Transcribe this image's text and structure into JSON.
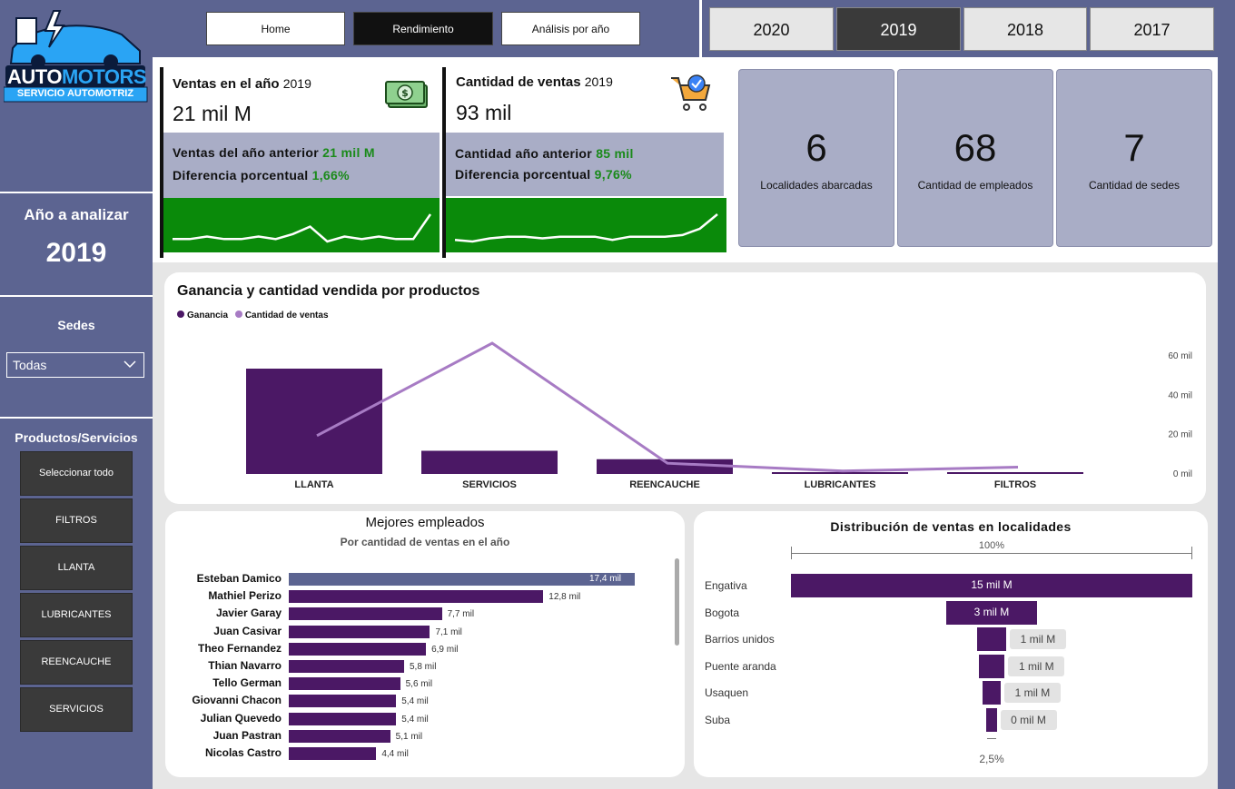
{
  "brand": {
    "name_a": "AUTO",
    "name_b": "MOTORS",
    "tagline": "SERVICIO AUTOMOTRIZ",
    "color_dark": "#0b1b3b",
    "color_blue": "#2aa4f4"
  },
  "nav": {
    "buttons": [
      {
        "label": "Home",
        "active": false
      },
      {
        "label": "Rendimiento",
        "active": true
      },
      {
        "label": "Análisis por año",
        "active": false
      }
    ],
    "years": [
      {
        "label": "2020",
        "active": false
      },
      {
        "label": "2019",
        "active": true
      },
      {
        "label": "2018",
        "active": false
      },
      {
        "label": "2017",
        "active": false
      }
    ]
  },
  "sidebar": {
    "year_title": "Año a analizar",
    "year_value": "2019",
    "sedes_title": "Sedes",
    "sedes_selected": "Todas",
    "products_title": "Productos/Servicios",
    "products": [
      "Seleccionar todo",
      "FILTROS",
      "LLANTA",
      "LUBRICANTES",
      "REENCAUCHE",
      "SERVICIOS"
    ]
  },
  "kpis": {
    "ventas": {
      "title": "Ventas en el año",
      "year": "2019",
      "value": "21 mil M",
      "prev_label": "Ventas del año anterior",
      "prev_value": "21 mil M",
      "diff_label": "Diferencia porcentual",
      "diff_value": "1,66%",
      "icon": "money-icon",
      "sparkline": [
        20,
        20,
        21,
        20,
        20,
        21,
        20,
        22,
        25,
        19,
        21,
        20,
        21,
        20,
        20,
        30
      ]
    },
    "cantidad": {
      "title": "Cantidad de ventas",
      "year": "2019",
      "value": "93 mil",
      "prev_label": "Cantidad año anterior",
      "prev_value": "85 mil",
      "diff_label": "Diferencia porcentual",
      "diff_value": "9,76%",
      "icon": "shopping-cart-icon",
      "sparkline": [
        6,
        5,
        7,
        8,
        8,
        7,
        8,
        8,
        8,
        6,
        8,
        8,
        8,
        9,
        13,
        22
      ]
    }
  },
  "stats": [
    {
      "value": "6",
      "label": "Localidades abarcadas"
    },
    {
      "value": "68",
      "label": "Cantidad de empleados"
    },
    {
      "value": "7",
      "label": "Cantidad de sedes"
    }
  ],
  "colors": {
    "bar_purple": "#4b1865",
    "line_lavender": "#a77bc4",
    "spark_green": "#0a8a0a",
    "green_text": "#1a8a1a",
    "top_employee": "#5c6491",
    "kpi_gray": "#a9adc6"
  },
  "chart_products": {
    "title": "Ganancia y cantidad vendida por productos",
    "legend": [
      "Ganancia",
      "Cantidad de ventas"
    ],
    "y_ticks": [
      "60 mil",
      "40 mil",
      "20 mil",
      "0 mil"
    ],
    "chart_data": {
      "type": "bar",
      "categories": [
        "LLANTA",
        "SERVICIOS",
        "REENCAUCHE",
        "LUBRICANTES",
        "FILTROS"
      ],
      "series": [
        {
          "name": "Ganancia",
          "values": [
            1.0,
            0.22,
            0.14,
            0.01,
            0.01
          ]
        },
        {
          "name": "Cantidad de ventas",
          "values": [
            19,
            66,
            5,
            1,
            3
          ]
        }
      ],
      "ylim": [
        0,
        60
      ]
    }
  },
  "chart_employees": {
    "title": "Mejores empleados",
    "subtitle": "Por cantidad de ventas en el año",
    "chart_data": {
      "type": "bar",
      "categories": [
        "Esteban Damico",
        "Mathiel Perizo",
        "Javier Garay",
        "Juan Casivar",
        "Theo Fernandez",
        "Thian Navarro",
        "Tello German",
        "Giovanni Chacon",
        "Julian Quevedo",
        "Juan Pastran",
        "Nicolas Castro"
      ],
      "values": [
        17.4,
        12.8,
        7.7,
        7.1,
        6.9,
        5.8,
        5.6,
        5.4,
        5.4,
        5.1,
        4.4
      ],
      "labels": [
        "17,4 mil",
        "12,8 mil",
        "7,7 mil",
        "7,1 mil",
        "6,9 mil",
        "5,8 mil",
        "5,6 mil",
        "5,4 mil",
        "5,4 mil",
        "5,1 mil",
        "4,4 mil"
      ]
    }
  },
  "chart_distribution": {
    "title": "Distribución de ventas en localidades",
    "top_label": "100%",
    "bottom_label": "2,5%",
    "chart_data": {
      "type": "bar",
      "categories": [
        "Engativa",
        "Bogota",
        "Barrios unidos",
        "Puente aranda",
        "Usaquen",
        "Suba"
      ],
      "values": [
        15,
        3,
        1,
        1,
        1,
        0
      ],
      "labels": [
        "15 mil M",
        "3 mil M",
        "1 mil M",
        "1 mil M",
        "1 mil M",
        "0 mil M"
      ],
      "widths_pct": [
        100,
        22.5,
        7.2,
        6.5,
        4.5,
        2.5
      ]
    }
  }
}
